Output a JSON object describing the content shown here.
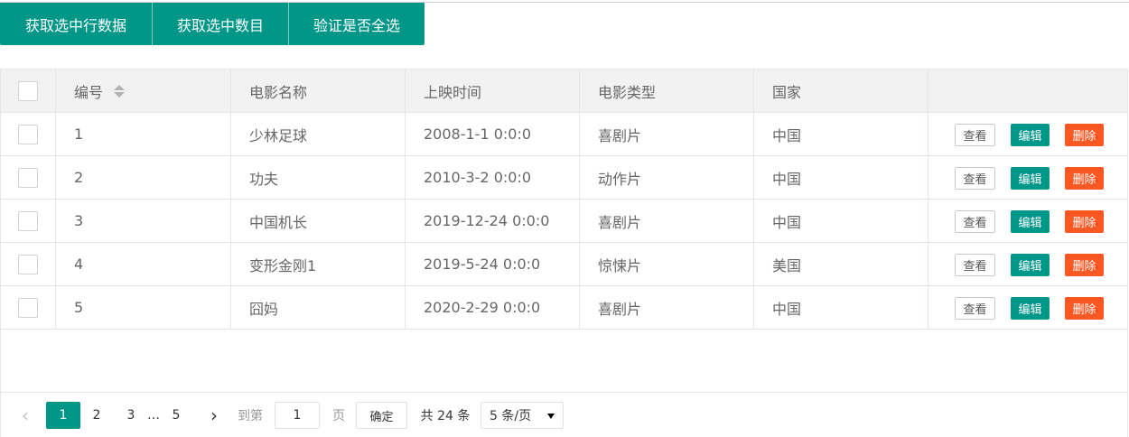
{
  "toolbar": {
    "buttons": [
      "获取选中行数据",
      "获取选中数目",
      "验证是否全选"
    ]
  },
  "table": {
    "headers": [
      "编号",
      "电影名称",
      "上映时间",
      "电影类型",
      "国家"
    ],
    "rows": [
      {
        "id": "1",
        "name": "少林足球",
        "date": "2008-1-1 0:0:0",
        "type": "喜剧片",
        "country": "中国"
      },
      {
        "id": "2",
        "name": "功夫",
        "date": "2010-3-2 0:0:0",
        "type": "动作片",
        "country": "中国"
      },
      {
        "id": "3",
        "name": "中国机长",
        "date": "2019-12-24 0:0:0",
        "type": "喜剧片",
        "country": "中国"
      },
      {
        "id": "4",
        "name": "变形金刚1",
        "date": "2019-5-24 0:0:0",
        "type": "惊悚片",
        "country": "美国"
      },
      {
        "id": "5",
        "name": "囧妈",
        "date": "2020-2-29 0:0:0",
        "type": "喜剧片",
        "country": "中国"
      }
    ],
    "actions": {
      "view": "查看",
      "edit": "编辑",
      "delete": "删除"
    }
  },
  "pager": {
    "prev": "‹",
    "pages": [
      "1",
      "2",
      "3",
      "5"
    ],
    "ellipsis": "…",
    "current": "1",
    "next": "›",
    "goto_label": "到第",
    "goto_value": "1",
    "page_unit": "页",
    "confirm": "确定",
    "total": "共 24 条",
    "limit": "5 条/页"
  },
  "colors": {
    "primary": "#009688",
    "danger": "#ff5722",
    "border": "#e6e6e6",
    "header_bg": "#f2f2f2"
  }
}
